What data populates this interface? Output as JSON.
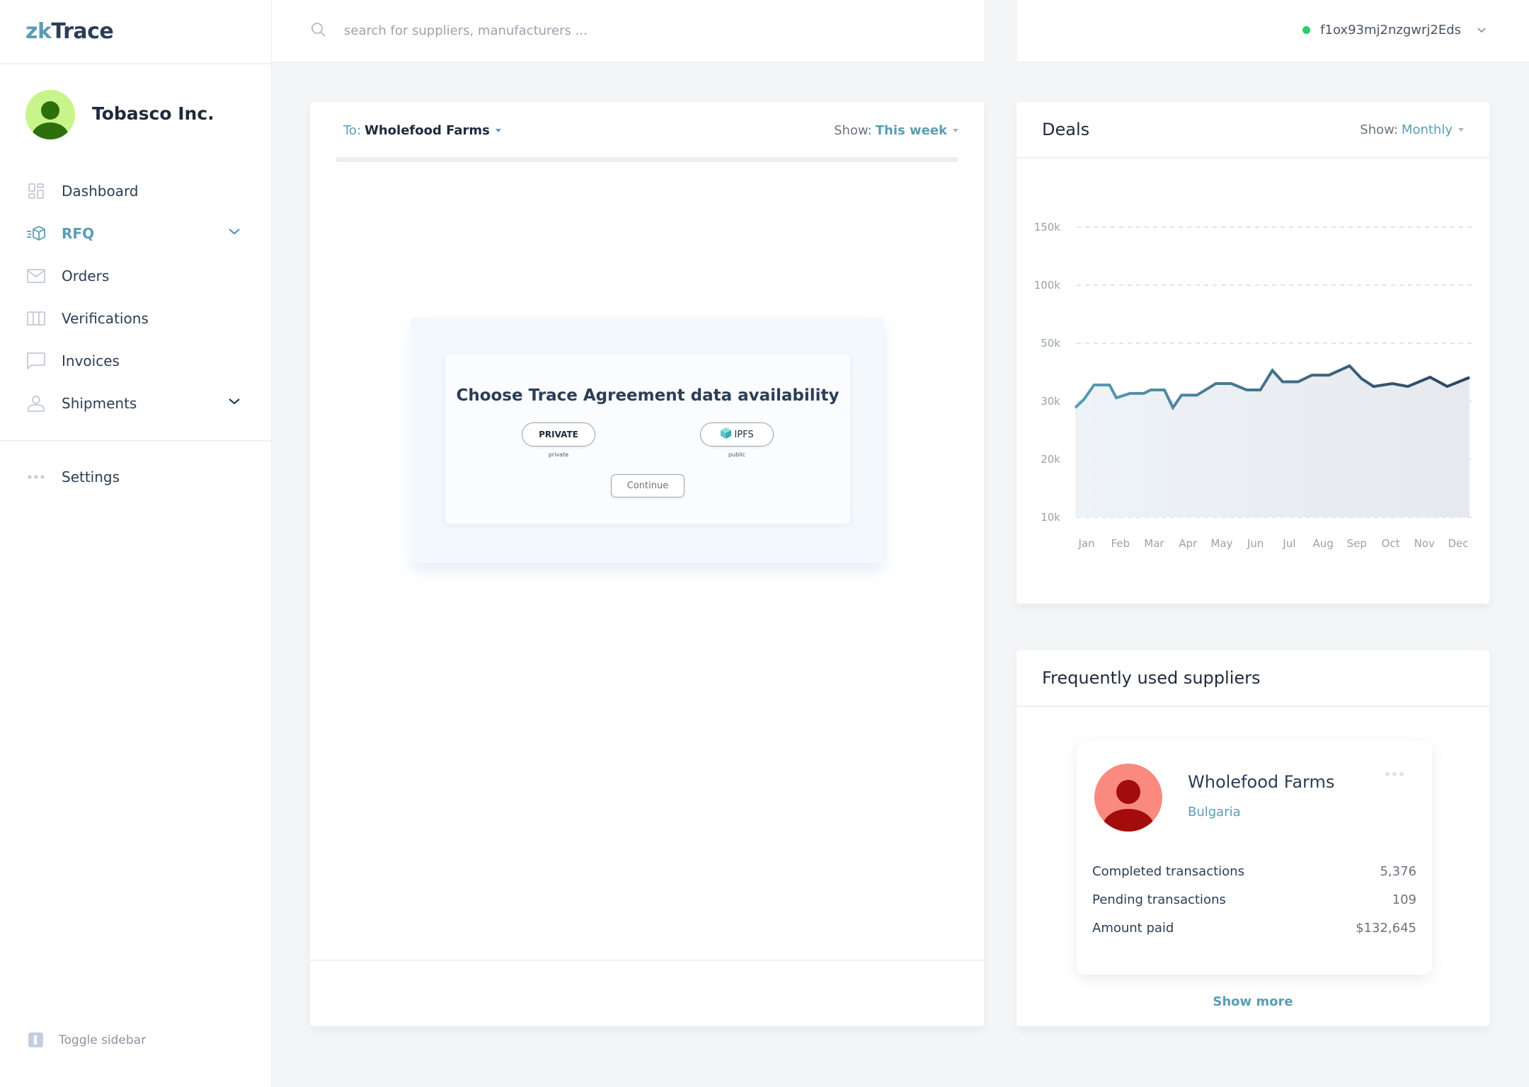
{
  "app": {
    "logo_prefix": "zk",
    "logo_suffix": "Trace"
  },
  "profile": {
    "org_name": "Tobasco Inc."
  },
  "sidebar": {
    "items": [
      {
        "label": "Dashboard",
        "icon": "dashboard-icon",
        "active": false,
        "expandable": false
      },
      {
        "label": "RFQ",
        "icon": "rfq-box-icon",
        "active": true,
        "expandable": true
      },
      {
        "label": "Orders",
        "icon": "mail-icon",
        "active": false,
        "expandable": false
      },
      {
        "label": "Verifications",
        "icon": "columns-icon",
        "active": false,
        "expandable": false
      },
      {
        "label": "Invoices",
        "icon": "chat-bubble-icon",
        "active": false,
        "expandable": false
      },
      {
        "label": "Shipments",
        "icon": "user-icon",
        "active": false,
        "expandable": true
      }
    ],
    "settings_label": "Settings",
    "toggle_label": "Toggle sidebar"
  },
  "search": {
    "placeholder": "search for suppliers, manufacturers ...",
    "value": ""
  },
  "wallet": {
    "address": "f1ox93mj2nzgwrj2Eds",
    "status_color": "#2fca6b"
  },
  "rfq_panel": {
    "to_label": "To:",
    "to_value": "Wholefood Farms",
    "show_label": "Show:",
    "show_value": "This week",
    "modal": {
      "title": "Choose Trace Agreement data availability",
      "options": [
        {
          "label": "PRIVATE",
          "caption": "private"
        },
        {
          "label": "IPFS",
          "caption": "public"
        }
      ],
      "continue_label": "Continue"
    }
  },
  "deals": {
    "title": "Deals",
    "show_label": "Show:",
    "show_value": "Monthly"
  },
  "chart_data": {
    "type": "area",
    "title": "Deals",
    "xlabel": "",
    "ylabel": "",
    "categories": [
      "Jan",
      "Feb",
      "Mar",
      "Apr",
      "May",
      "Jun",
      "Jul",
      "Aug",
      "Sep",
      "Oct",
      "Nov",
      "Dec"
    ],
    "y_ticks": [
      "10k",
      "20k",
      "30k",
      "50k",
      "100k",
      "150k"
    ],
    "y_tick_values": [
      10000,
      20000,
      30000,
      50000,
      100000,
      150000
    ],
    "y_scale": "categorical-ticks (equally spaced)",
    "grid": true,
    "legend": "none",
    "series": [
      {
        "name": "Deals",
        "x_month_pos": [
          0.0,
          0.25,
          0.55,
          1.0,
          1.2,
          1.6,
          2.0,
          2.2,
          2.6,
          2.85,
          3.1,
          3.55,
          4.1,
          4.55,
          5.0,
          5.4,
          5.75,
          6.05,
          6.5,
          6.9,
          7.4,
          8.0,
          8.35,
          8.7,
          9.25,
          9.7,
          10.35,
          10.85,
          11.5
        ],
        "values": [
          28900,
          30600,
          35600,
          35600,
          31200,
          32700,
          32700,
          33900,
          33900,
          28900,
          32100,
          32100,
          36100,
          36100,
          33900,
          33900,
          40600,
          36700,
          36700,
          39000,
          39000,
          42200,
          37800,
          35100,
          36100,
          35100,
          38300,
          35100,
          38200
        ]
      }
    ],
    "line_color_start": "#5a9db4",
    "line_color_end": "#2c4260"
  },
  "suppliers": {
    "title": "Frequently used suppliers",
    "items": [
      {
        "name": "Wholefood Farms",
        "country": "Bulgaria",
        "stats": [
          {
            "label": "Completed transactions",
            "value": "5,376"
          },
          {
            "label": "Pending transactions",
            "value": "109"
          },
          {
            "label": "Amount paid",
            "value": "$132,645"
          }
        ]
      }
    ],
    "show_more_label": "Show more"
  }
}
